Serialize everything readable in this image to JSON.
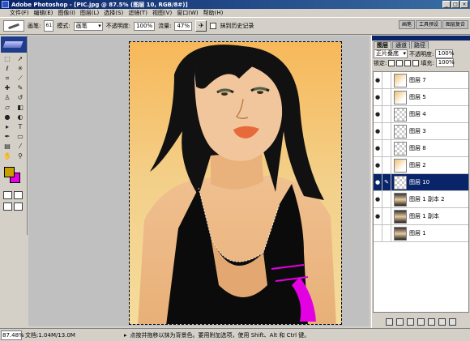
{
  "titlebar": {
    "title": "Adobe Photoshop - [PIC.jpg @ 87.5% (图层 10, RGB/8#)]"
  },
  "menu": [
    "文件(F)",
    "编辑(E)",
    "图像(I)",
    "图层(L)",
    "选择(S)",
    "滤镜(T)",
    "视图(V)",
    "窗口(W)",
    "帮助(H)"
  ],
  "options": {
    "brush_label": "画笔:",
    "brush_size": "61",
    "mode_label": "模式:",
    "mode_value": "画笔",
    "opacity_label": "不透明度:",
    "opacity_value": "100%",
    "flow_label": "流量:",
    "flow_value": "47%",
    "history_checkbox_label": "抹到历史记录"
  },
  "palette_well": [
    "画笔",
    "工具预设",
    "图层复合"
  ],
  "layers_panel": {
    "tabs": [
      "图层",
      "通道",
      "路径"
    ],
    "blend_mode": "正片叠底",
    "opacity_label": "不透明度:",
    "opacity_value": "100%",
    "lock_label": "锁定:",
    "fill_label": "填充:",
    "fill_value": "100%",
    "layers": [
      {
        "name": "图层 7",
        "thumb": "orange",
        "selected": false,
        "visible": true
      },
      {
        "name": "图层 5",
        "thumb": "orange",
        "selected": false,
        "visible": true
      },
      {
        "name": "图层 4",
        "thumb": "transparent",
        "selected": false,
        "visible": true
      },
      {
        "name": "图层 3",
        "thumb": "transparent",
        "selected": false,
        "visible": true
      },
      {
        "name": "图层 8",
        "thumb": "transparent",
        "selected": false,
        "visible": true
      },
      {
        "name": "图层 2",
        "thumb": "orange",
        "selected": false,
        "visible": true
      },
      {
        "name": "图层 10",
        "thumb": "transparent",
        "selected": true,
        "visible": true
      },
      {
        "name": "图层 1 副本 2",
        "thumb": "photo",
        "selected": false,
        "visible": true
      },
      {
        "name": "图层 1 副本",
        "thumb": "photo",
        "selected": false,
        "visible": true
      },
      {
        "name": "图层 1",
        "thumb": "photo",
        "selected": false,
        "visible": false
      }
    ]
  },
  "statusbar": {
    "zoom": "87.48%",
    "doc_info": "文档:1.04M/13.0M",
    "hint": "点按并拖移以抹为背景色。要用附加选项，使用 Shift、Alt 和 Ctrl 键。"
  },
  "colors": {
    "foreground": "#c8a000",
    "background": "#e400e4",
    "selection": "#0a246a"
  }
}
